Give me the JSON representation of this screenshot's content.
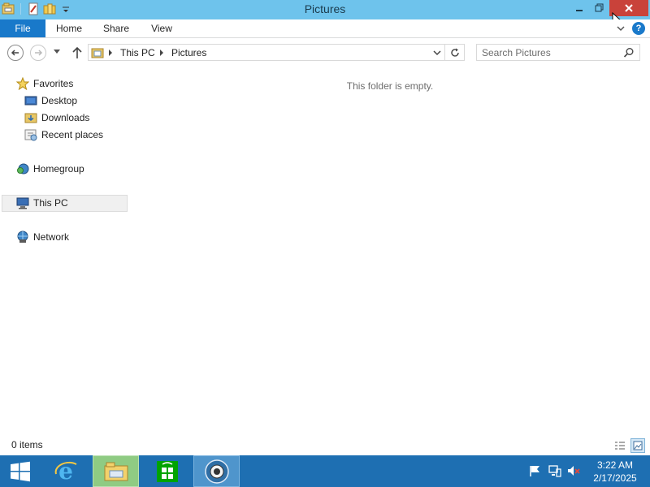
{
  "window": {
    "title": "Pictures",
    "qat": {
      "icons": [
        "folder-app-icon",
        "properties-icon",
        "new-folder-icon",
        "customize-qat-icon"
      ]
    },
    "controls": [
      "minimize",
      "restore",
      "close"
    ]
  },
  "ribbon": {
    "tabs": [
      {
        "label": "File",
        "active": true
      },
      {
        "label": "Home"
      },
      {
        "label": "Share"
      },
      {
        "label": "View"
      }
    ],
    "help_label": "?"
  },
  "address": {
    "breadcrumb": [
      "This PC",
      "Pictures"
    ],
    "search_placeholder": "Search Pictures"
  },
  "nav_pane": {
    "favorites": {
      "label": "Favorites",
      "items": [
        "Desktop",
        "Downloads",
        "Recent places"
      ]
    },
    "homegroup": "Homegroup",
    "this_pc": "This PC",
    "network": "Network",
    "selected": "This PC"
  },
  "content": {
    "empty_message": "This folder is empty."
  },
  "status_bar": {
    "item_count": "0 items",
    "view_mode": "large-icons"
  },
  "taskbar": {
    "apps": [
      "start",
      "internet-explorer",
      "file-explorer",
      "store",
      "app"
    ],
    "active_app": "file-explorer",
    "tray_icons": [
      "action-center-flag-icon",
      "network-icon",
      "volume-muted-icon"
    ],
    "clock": {
      "time": "3:22 AM",
      "date": "2/17/2025"
    }
  },
  "colors": {
    "titlebar": "#6ec3ec",
    "close_button": "#c9423a",
    "file_tab": "#1979ca",
    "taskbar": "#1e6fb2"
  }
}
